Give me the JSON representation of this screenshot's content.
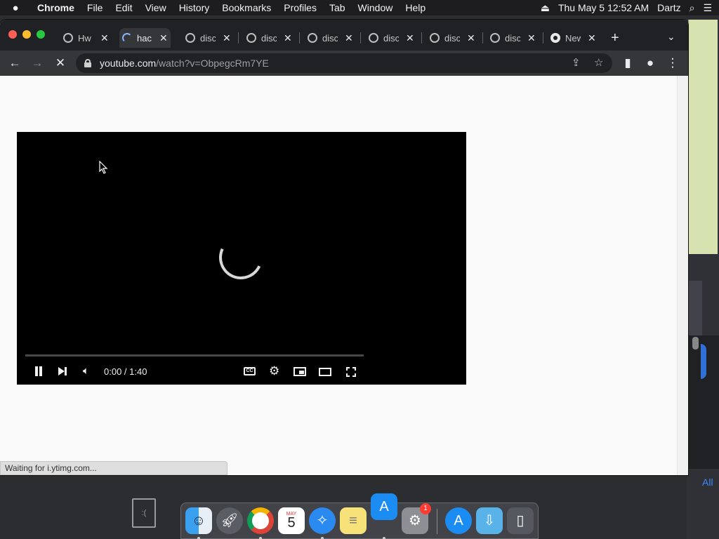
{
  "menubar": {
    "apple_icon": "apple-logo-icon",
    "app_name": "Chrome",
    "items": [
      "File",
      "Edit",
      "View",
      "History",
      "Bookmarks",
      "Profiles",
      "Tab",
      "Window",
      "Help"
    ],
    "clock": "Thu May 5  12:52 AM",
    "user": "Dartz"
  },
  "tabs": [
    {
      "title": "Hw",
      "icon": "globe-icon"
    },
    {
      "title": "hac",
      "icon": "loading-spinner-icon",
      "active": true
    },
    {
      "title": "disc",
      "icon": "globe-icon"
    },
    {
      "title": "disc",
      "icon": "globe-icon"
    },
    {
      "title": "disc",
      "icon": "globe-icon"
    },
    {
      "title": "disc",
      "icon": "globe-icon"
    },
    {
      "title": "disc",
      "icon": "globe-icon"
    },
    {
      "title": "disc",
      "icon": "globe-icon"
    },
    {
      "title": "New",
      "icon": "chrome-icon"
    }
  ],
  "address": {
    "host": "youtube.com",
    "path": "/watch?v=ObpegcRm7YE"
  },
  "player": {
    "time": "0:00 / 1:40",
    "progress_fraction": 0.0,
    "cc_label": "CC"
  },
  "status": {
    "text": "Waiting for i.ytimg.com..."
  },
  "desktop": {
    "right_link": "All"
  },
  "dock": {
    "calendar_month": "MAY",
    "calendar_day": "5",
    "settings_badge": "1"
  },
  "colors": {
    "tab_strip": "#202124",
    "toolbar": "#35363a",
    "accent_loading": "#8ab4f8",
    "youtube_red": "#ff0000"
  }
}
